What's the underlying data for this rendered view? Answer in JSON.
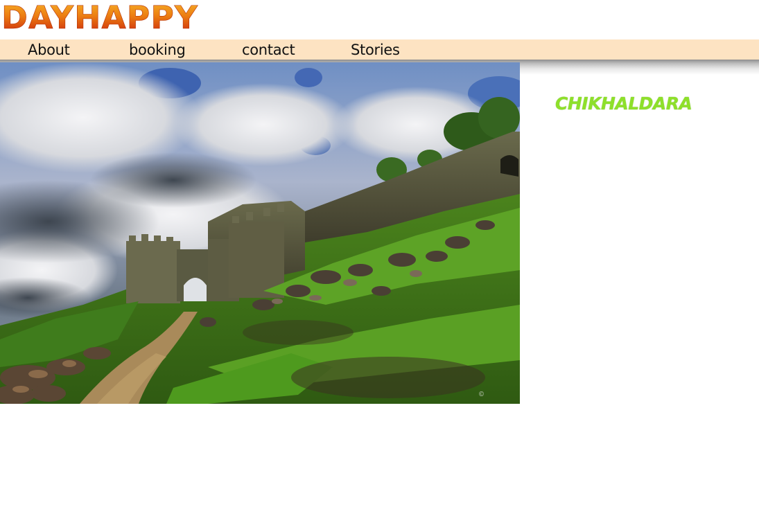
{
  "brand": {
    "logo_text": "DAYHAPPY",
    "logo_color_top": "#f2a21a",
    "logo_color_bottom": "#c8200c"
  },
  "nav": {
    "background": "#fde3c2",
    "items": [
      {
        "label": "About"
      },
      {
        "label": "booking"
      },
      {
        "label": "contact"
      },
      {
        "label": "Stories"
      }
    ]
  },
  "hero": {
    "subject": "fort ruins on a green hillside under a cloudy sky"
  },
  "side": {
    "title": "CHIKHALDARA",
    "title_color": "#8ee02a"
  }
}
